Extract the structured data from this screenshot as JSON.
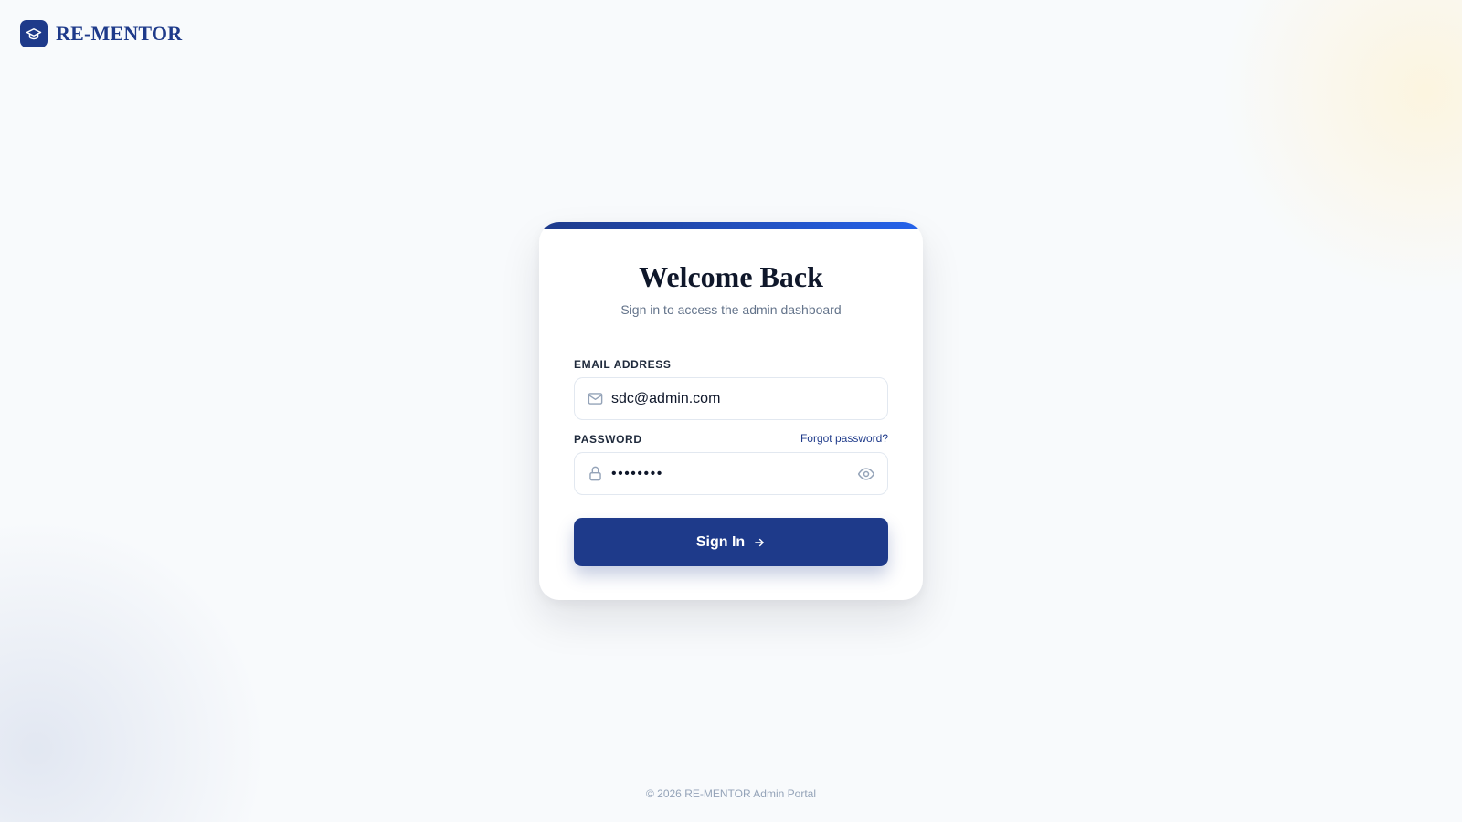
{
  "brand": {
    "name": "RE-MENTOR",
    "icon": "graduation-cap-icon"
  },
  "login_card": {
    "title": "Welcome Back",
    "subtitle": "Sign in to access the admin dashboard",
    "email": {
      "label": "EMAIL ADDRESS",
      "value": "sdc@admin.com",
      "icon": "mail-icon"
    },
    "password": {
      "label": "PASSWORD",
      "value": "••••••••",
      "icon": "lock-icon",
      "toggle_icon": "eye-icon"
    },
    "forgot_password": "Forgot password?",
    "submit_label": "Sign In",
    "submit_icon": "arrow-right-icon"
  },
  "footer": {
    "text": "© 2026 RE-MENTOR Admin Portal"
  },
  "colors": {
    "brand": "#1e3a8a",
    "accent_gradient_end": "#2563eb",
    "background": "#f8fafc",
    "muted_text": "#64748b"
  }
}
